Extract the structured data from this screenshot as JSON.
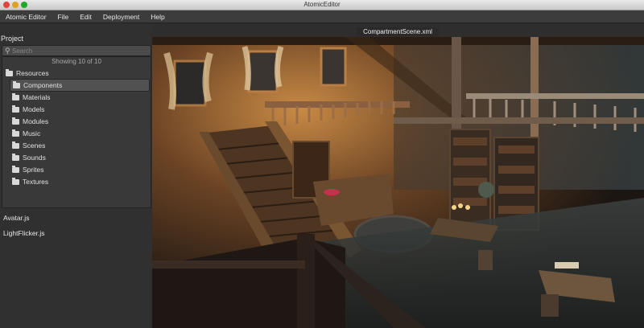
{
  "window": {
    "title": "AtomicEditor"
  },
  "menu": [
    "Atomic Editor",
    "File",
    "Edit",
    "Deployment",
    "Help"
  ],
  "project": {
    "title": "Project",
    "search_placeholder": "Search",
    "showing": "Showing 10 of 10",
    "root": "Resources",
    "folders": [
      "Components",
      "Materials",
      "Models",
      "Modules",
      "Music",
      "Scenes",
      "Sounds",
      "Sprites",
      "Textures"
    ],
    "selected_folder": "Components",
    "files": [
      "Avatar.js",
      "LightFlicker.js"
    ]
  },
  "editor": {
    "tab": "CompartmentScene.xml"
  },
  "colors": {
    "panel": "#303030",
    "menubar": "#3c3c3c",
    "selection": "#515151"
  },
  "icons": {
    "folder": "folder-icon",
    "search": "search-icon"
  }
}
